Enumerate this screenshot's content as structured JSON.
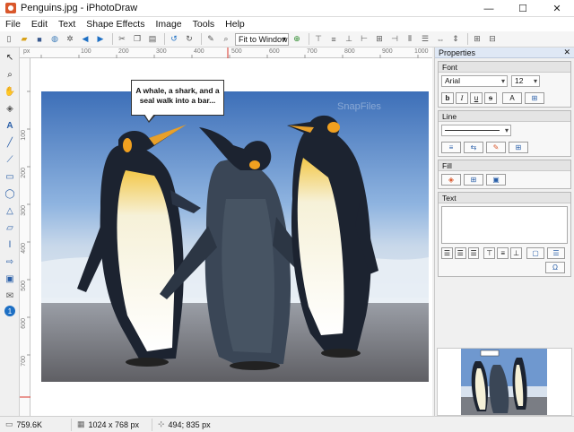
{
  "window": {
    "title": "Penguins.jpg - iPhotoDraw",
    "minimize": "—",
    "maximize": "☐",
    "close": "✕"
  },
  "menu": [
    "File",
    "Edit",
    "Text",
    "Shape Effects",
    "Image",
    "Tools",
    "Help"
  ],
  "toolbar": {
    "zoom": "Fit to Window"
  },
  "ruler": {
    "unit": "px",
    "x_ticks": [
      "100",
      "200",
      "300",
      "400",
      "500",
      "600",
      "700",
      "800",
      "900",
      "1000"
    ],
    "y_ticks": [
      "100",
      "200",
      "300",
      "400",
      "500",
      "600",
      "700"
    ]
  },
  "canvas": {
    "callout_text": "A whale, a shark, and a seal walk into a bar...",
    "watermark": "SnapFiles"
  },
  "panel": {
    "title": "Properties",
    "close": "✕",
    "font_section": "Font",
    "font_name": "Arial",
    "font_size": "12",
    "bold": "b",
    "italic": "I",
    "underline": "u",
    "strike": "s",
    "text_color": "A",
    "line_section": "Line",
    "fill_section": "Fill",
    "text_section": "Text",
    "omega": "Ω"
  },
  "status": {
    "file_size": "759.6K",
    "dimensions": "1024 x 768 px",
    "cursor": "494; 835 px"
  }
}
